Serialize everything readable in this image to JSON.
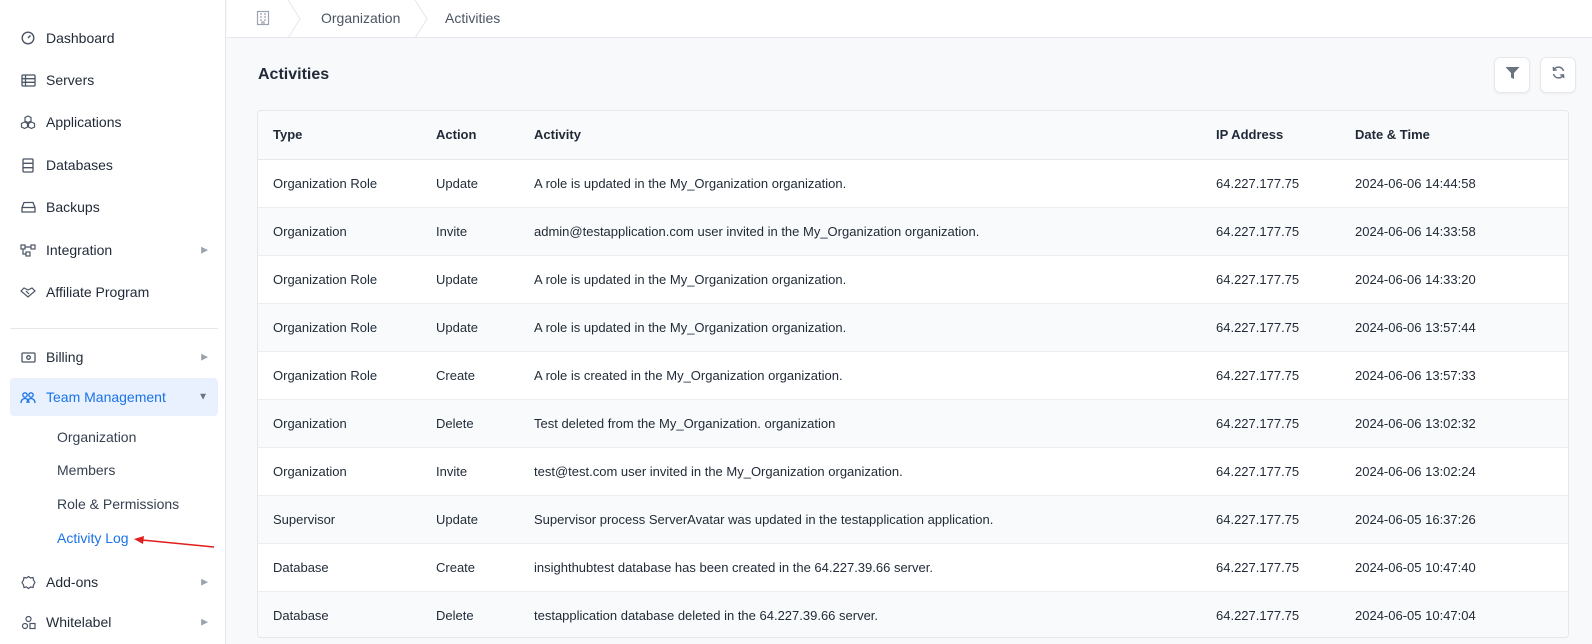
{
  "sidebar": {
    "items": [
      {
        "label": "Dashboard"
      },
      {
        "label": "Servers"
      },
      {
        "label": "Applications"
      },
      {
        "label": "Databases"
      },
      {
        "label": "Backups"
      },
      {
        "label": "Integration"
      },
      {
        "label": "Affiliate Program"
      },
      {
        "label": "Billing"
      },
      {
        "label": "Team Management"
      },
      {
        "label": "Add-ons"
      },
      {
        "label": "Whitelabel"
      }
    ],
    "team_sub": [
      {
        "label": "Organization"
      },
      {
        "label": "Members"
      },
      {
        "label": "Role & Permissions"
      },
      {
        "label": "Activity Log"
      }
    ]
  },
  "breadcrumb": {
    "items": [
      "Organization",
      "Activities"
    ]
  },
  "main": {
    "title": "Activities"
  },
  "table": {
    "headers": [
      "Type",
      "Action",
      "Activity",
      "IP Address",
      "Date & Time"
    ],
    "rows": [
      [
        "Organization Role",
        "Update",
        "A role is updated in the My_Organization organization.",
        "64.227.177.75",
        "2024-06-06 14:44:58"
      ],
      [
        "Organization",
        "Invite",
        "admin@testapplication.com user invited in the My_Organization organization.",
        "64.227.177.75",
        "2024-06-06 14:33:58"
      ],
      [
        "Organization Role",
        "Update",
        "A role is updated in the My_Organization organization.",
        "64.227.177.75",
        "2024-06-06 14:33:20"
      ],
      [
        "Organization Role",
        "Update",
        "A role is updated in the My_Organization organization.",
        "64.227.177.75",
        "2024-06-06 13:57:44"
      ],
      [
        "Organization Role",
        "Create",
        "A role is created in the My_Organization organization.",
        "64.227.177.75",
        "2024-06-06 13:57:33"
      ],
      [
        "Organization",
        "Delete",
        "Test deleted from the My_Organization. organization",
        "64.227.177.75",
        "2024-06-06 13:02:32"
      ],
      [
        "Organization",
        "Invite",
        "test@test.com user invited in the My_Organization organization.",
        "64.227.177.75",
        "2024-06-06 13:02:24"
      ],
      [
        "Supervisor",
        "Update",
        "Supervisor process ServerAvatar was updated in the testapplication application.",
        "64.227.177.75",
        "2024-06-05 16:37:26"
      ],
      [
        "Database",
        "Create",
        "insighthubtest database has been created in the 64.227.39.66 server.",
        "64.227.177.75",
        "2024-06-05 10:47:40"
      ],
      [
        "Database",
        "Delete",
        "testapplication database deleted in the 64.227.39.66 server.",
        "64.227.177.75",
        "2024-06-05 10:47:04"
      ]
    ]
  },
  "colors": {
    "accent": "#1a73e8",
    "active_bg": "#e8f1fd",
    "annotation_arrow": "#e11d1d"
  }
}
